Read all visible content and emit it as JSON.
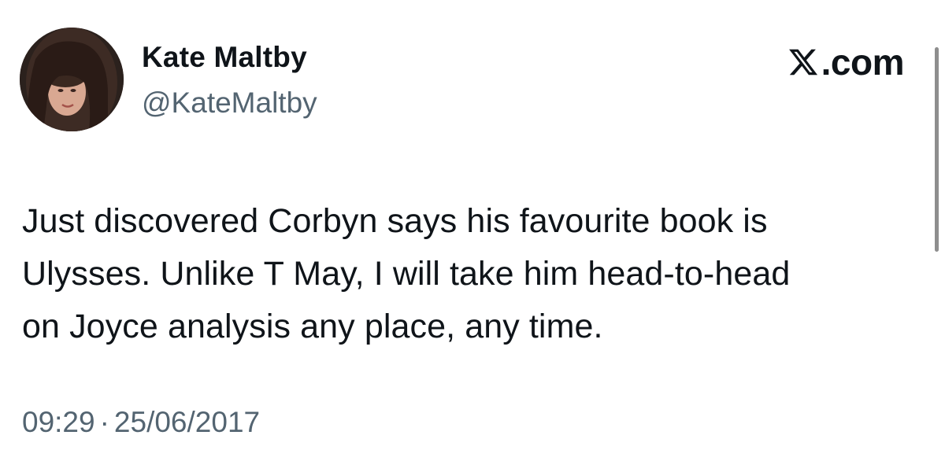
{
  "author": {
    "display_name": "Kate Maltby",
    "handle": "@KateMaltby"
  },
  "brand": {
    "icon": "x-logo-icon",
    "label": ".com"
  },
  "tweet": {
    "text": "Just discovered Corbyn says his favourite book is\nUlysses. Unlike T May, I will take him head-to-head\non Joyce analysis any place, any time.",
    "time": "09:29",
    "separator": "·",
    "date": "25/06/2017"
  },
  "colors": {
    "text_primary": "#0f1419",
    "text_secondary": "#536471",
    "background": "#ffffff"
  }
}
